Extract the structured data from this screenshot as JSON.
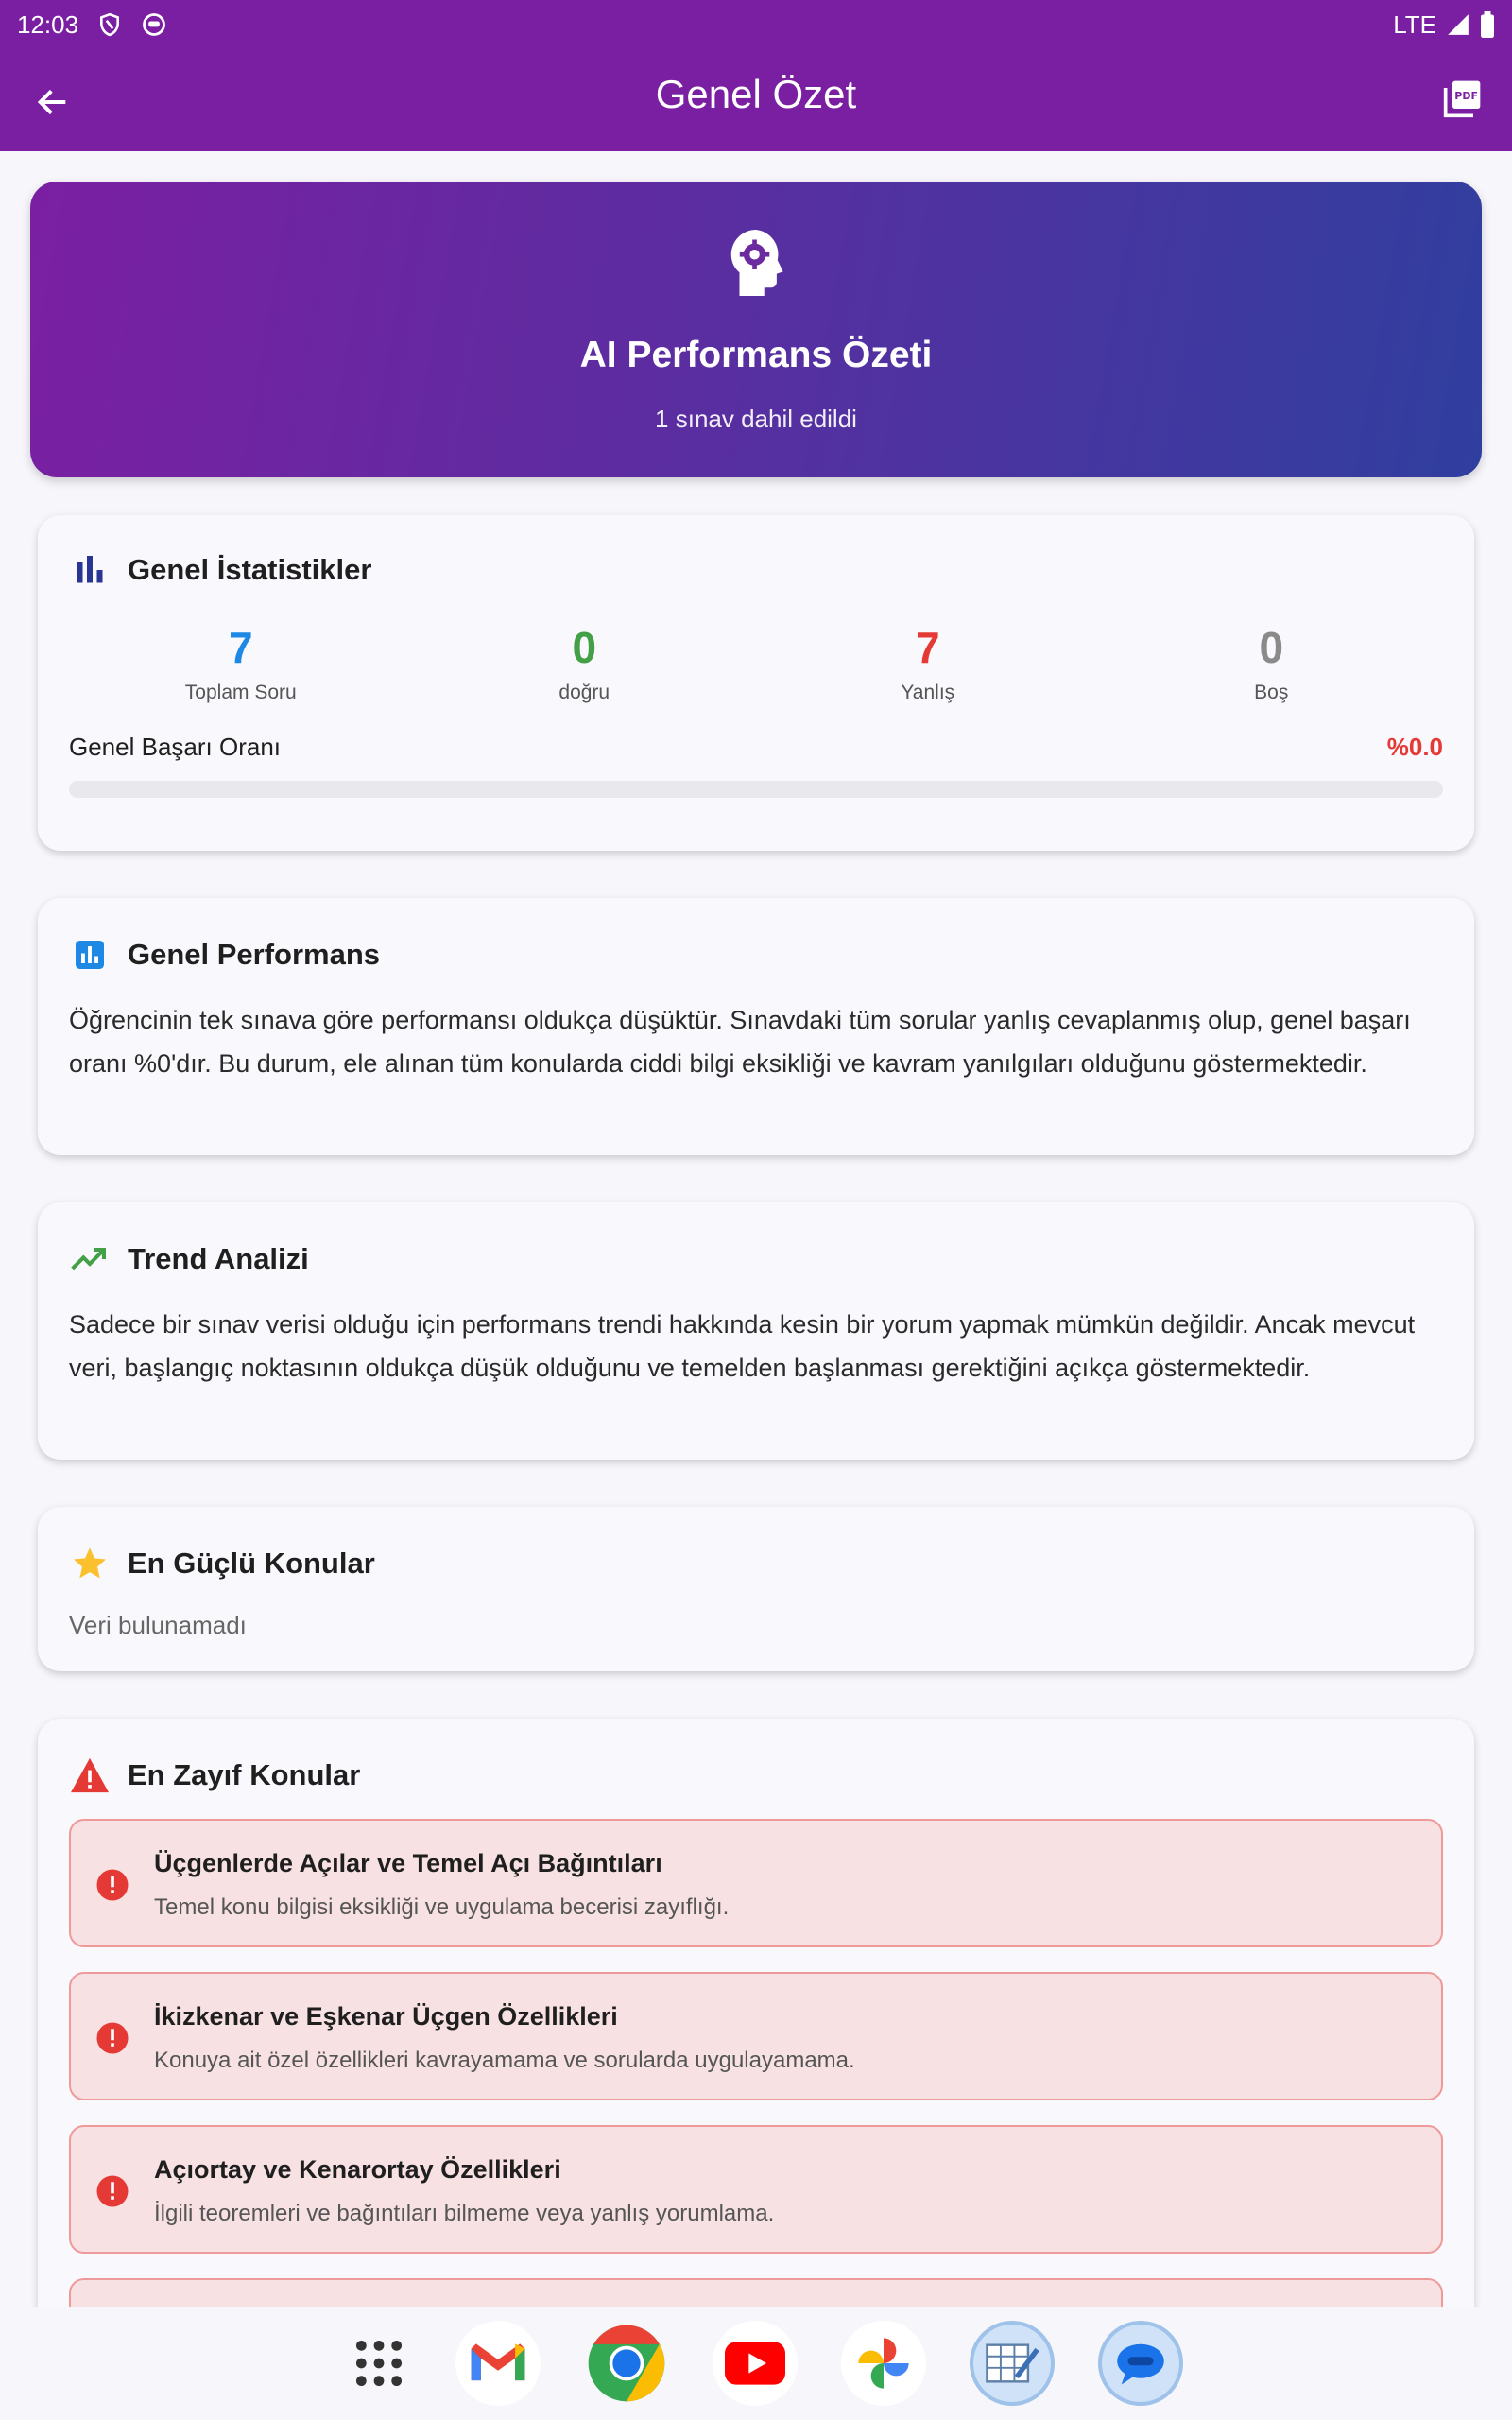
{
  "status": {
    "time": "12:03",
    "network": "LTE"
  },
  "toolbar": {
    "title": "Genel Özet"
  },
  "hero": {
    "title": "AI Performans Özeti",
    "subtitle": "1 sınav dahil edildi"
  },
  "stats_card": {
    "title": "Genel İstatistikler",
    "items": [
      {
        "value": "7",
        "label": "Toplam Soru",
        "color": "#1e88e5"
      },
      {
        "value": "0",
        "label": "doğru",
        "color": "#43a047"
      },
      {
        "value": "7",
        "label": "Yanlış",
        "color": "#e53935"
      },
      {
        "value": "0",
        "label": "Boş",
        "color": "#8a8a8a"
      }
    ],
    "rate_label": "Genel Başarı Oranı",
    "rate_value": "%0.0",
    "rate_fraction": 0.0
  },
  "performance_card": {
    "title": "Genel Performans",
    "text": "Öğrencinin tek sınava göre performansı oldukça düşüktür. Sınavdaki tüm sorular yanlış cevaplanmış olup, genel başarı oranı %0'dır. Bu durum, ele alınan tüm konularda ciddi bilgi eksikliği ve kavram yanılgıları olduğunu göstermektedir."
  },
  "trend_card": {
    "title": "Trend Analizi",
    "text": "Sadece bir sınav verisi olduğu için performans trendi hakkında kesin bir yorum yapmak mümkün değildir. Ancak mevcut veri, başlangıç noktasının oldukça düşük olduğunu ve temelden başlanması gerektiğini açıkça göstermektedir."
  },
  "strong_card": {
    "title": "En Güçlü Konular",
    "empty_text": "Veri bulunamadı"
  },
  "weak_card": {
    "title": "En Zayıf Konular",
    "items": [
      {
        "title": "Üçgenlerde Açılar ve Temel Açı Bağıntıları",
        "desc": "Temel konu bilgisi eksikliği ve uygulama becerisi zayıflığı."
      },
      {
        "title": "İkizkenar ve Eşkenar Üçgen Özellikleri",
        "desc": "Konuya ait özel özellikleri kavrayamama ve sorularda uygulayamama."
      },
      {
        "title": "Açıortay ve Kenarortay Özellikleri",
        "desc": "İlgili teoremleri ve bağıntıları bilmeme veya yanlış yorumlama."
      }
    ]
  },
  "colors": {
    "appbar": "#7b1fa2",
    "hero_start": "#7b1fa2",
    "hero_end": "#303f9f",
    "danger": "#e53935"
  },
  "dock": [
    "apps-grid-icon",
    "gmail-icon",
    "chrome-icon",
    "youtube-icon",
    "photos-icon",
    "sheets-app-icon",
    "messages-icon"
  ]
}
